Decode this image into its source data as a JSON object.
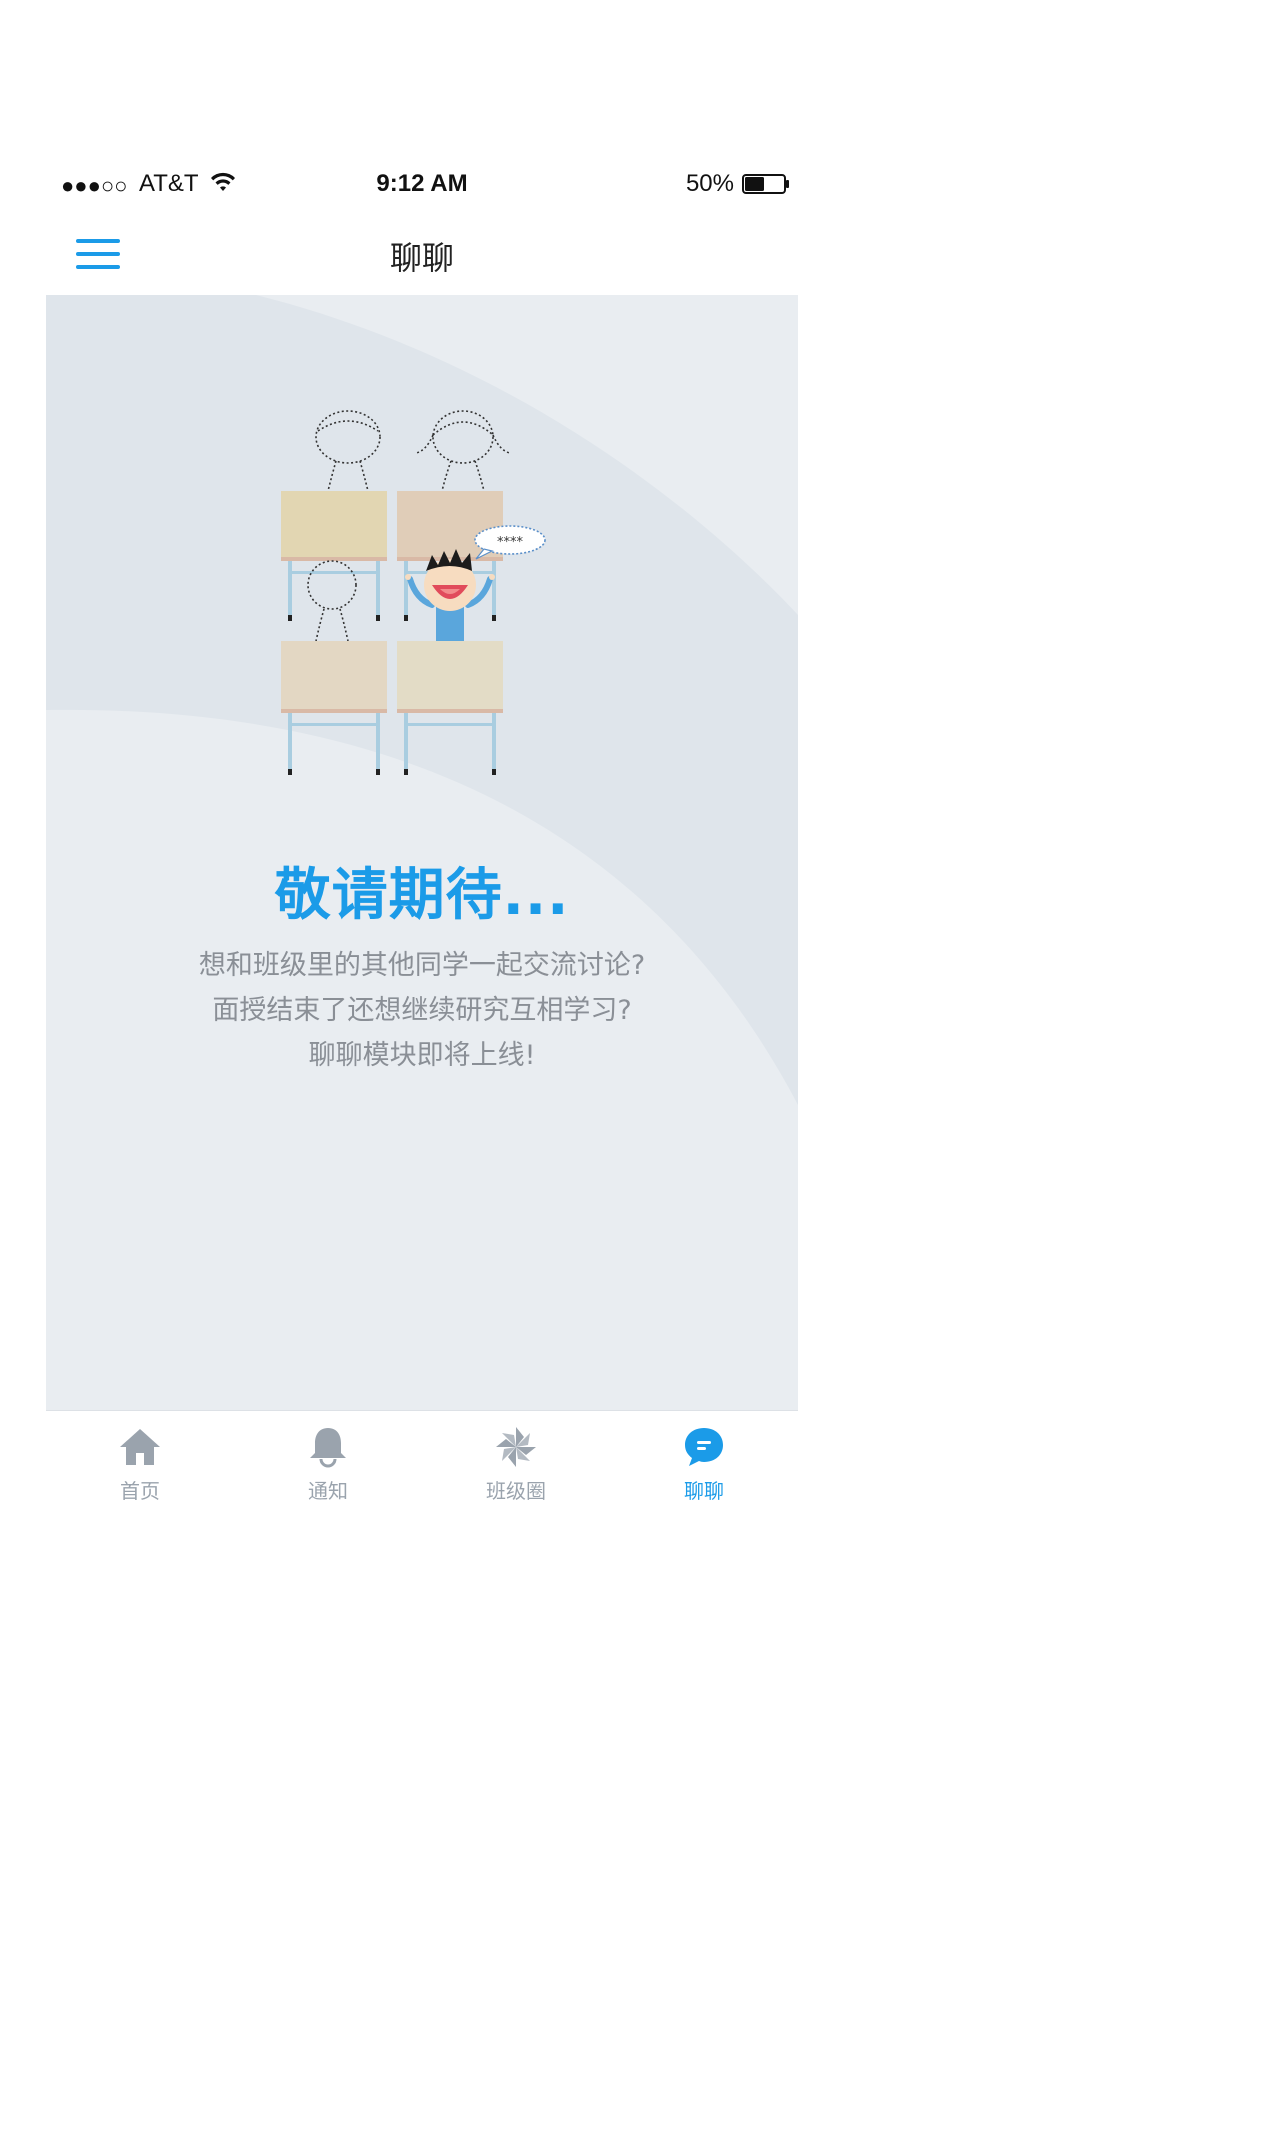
{
  "status_bar": {
    "signal": "●●●○○",
    "carrier": "AT&T",
    "time": "9:12 AM",
    "battery_percent": "50%",
    "battery_level": 0.5
  },
  "nav": {
    "title": "聊聊",
    "menu_icon": "hamburger-menu-icon"
  },
  "content": {
    "bubble_text": "****",
    "headline": "敬请期待...",
    "description_lines": [
      "想和班级里的其他同学一起交流讨论?",
      "面授结束了还想继续研究互相学习?",
      "聊聊模块即将上线!"
    ]
  },
  "tabs": [
    {
      "label": "首页",
      "icon": "home-icon",
      "active": false
    },
    {
      "label": "通知",
      "icon": "bell-icon",
      "active": false
    },
    {
      "label": "班级圈",
      "icon": "pinwheel-icon",
      "active": false
    },
    {
      "label": "聊聊",
      "icon": "chat-bubble-icon",
      "active": true
    }
  ],
  "colors": {
    "accent": "#1b9be8",
    "content_bg": "#e9edf1",
    "arc_bg": "#dfe5eb",
    "tab_inactive": "#9aa3ad",
    "text_muted": "#8a8f96"
  }
}
